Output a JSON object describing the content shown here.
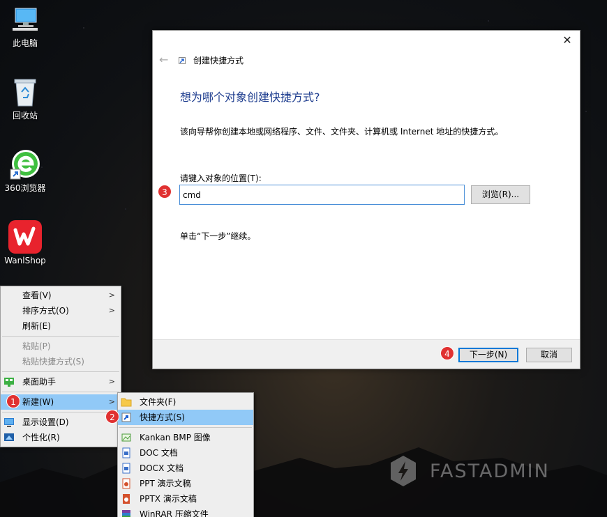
{
  "desktop": {
    "icons": [
      {
        "label": "此电脑",
        "icon": "computer-icon"
      },
      {
        "label": "回收站",
        "icon": "recycle-bin-icon"
      },
      {
        "label": "360浏览器",
        "icon": "browser-360-icon"
      },
      {
        "label": "WanlShop",
        "icon": "wanlshop-icon"
      }
    ],
    "watermark": "FASTADMIN"
  },
  "context_menu": {
    "items": [
      {
        "label": "查看(V)",
        "has_submenu": true
      },
      {
        "label": "排序方式(O)",
        "has_submenu": true
      },
      {
        "label": "刷新(E)"
      },
      {
        "label": "粘贴(P)",
        "disabled": true
      },
      {
        "label": "粘贴快捷方式(S)",
        "disabled": true
      },
      {
        "label": "桌面助手",
        "has_submenu": true,
        "icon": "desktop-helper-icon"
      },
      {
        "label": "新建(W)",
        "has_submenu": true,
        "selected": true
      },
      {
        "label": "显示设置(D)",
        "icon": "display-icon"
      },
      {
        "label": "个性化(R)",
        "icon": "personalize-icon"
      }
    ]
  },
  "new_submenu": {
    "items": [
      {
        "label": "文件夹(F)",
        "icon": "folder-icon"
      },
      {
        "label": "快捷方式(S)",
        "icon": "shortcut-icon",
        "selected": true
      },
      {
        "label": "Kankan BMP 图像",
        "icon": "bmp-icon"
      },
      {
        "label": "DOC 文档",
        "icon": "doc-icon"
      },
      {
        "label": "DOCX 文档",
        "icon": "docx-icon"
      },
      {
        "label": "PPT 演示文稿",
        "icon": "ppt-icon"
      },
      {
        "label": "PPTX 演示文稿",
        "icon": "pptx-icon"
      },
      {
        "label": "WinRAR 压缩文件",
        "icon": "winrar-icon"
      }
    ]
  },
  "wizard": {
    "title": "创建快捷方式",
    "heading": "想为哪个对象创建快捷方式?",
    "description": "该向导帮你创建本地或网络程序、文件、文件夹、计算机或 Internet 地址的快捷方式。",
    "location_label": "请键入对象的位置(T):",
    "location_value": "cmd",
    "browse_label": "浏览(R)...",
    "hint": "单击“下一步”继续。",
    "next_label": "下一步(N)",
    "cancel_label": "取消",
    "close_glyph": "✕",
    "back_glyph": "←"
  },
  "badges": [
    "1",
    "2",
    "3",
    "4"
  ],
  "colors": {
    "heading": "#1e3d8f",
    "menu_selected": "#91c9f7",
    "badge": "#e03131",
    "focus": "#0078d7"
  }
}
